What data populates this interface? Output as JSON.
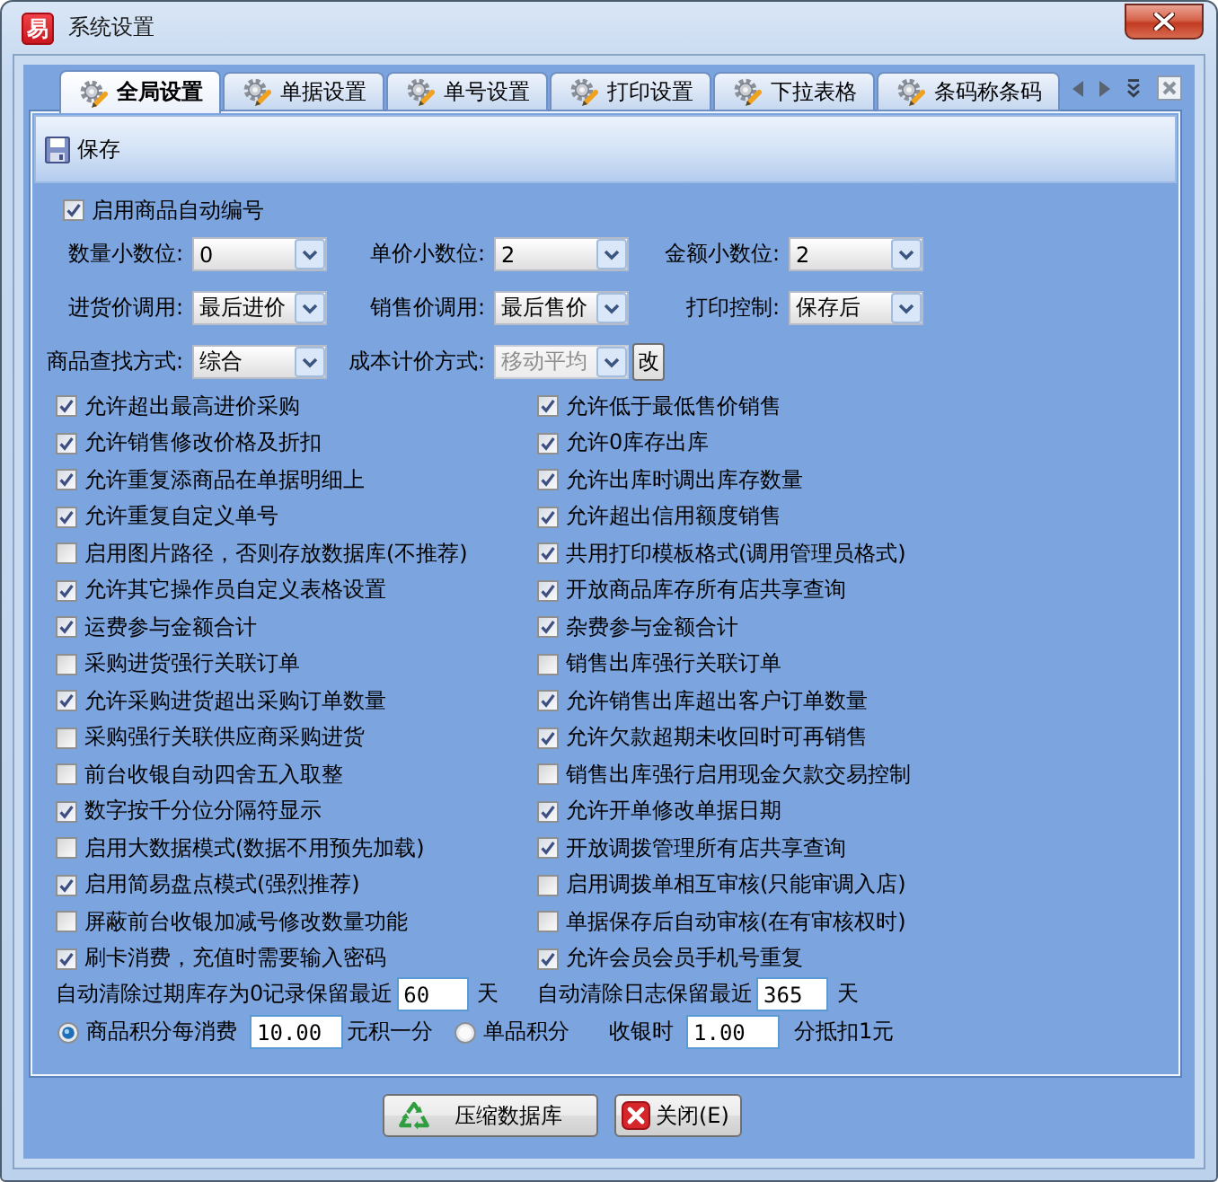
{
  "window": {
    "logo": "易",
    "title": "系统设置"
  },
  "tabs": [
    {
      "label": "全局设置",
      "selected": true
    },
    {
      "label": "单据设置",
      "selected": false
    },
    {
      "label": "单号设置",
      "selected": false
    },
    {
      "label": "打印设置",
      "selected": false
    },
    {
      "label": "下拉表格",
      "selected": false
    },
    {
      "label": "条码称条码",
      "selected": false
    }
  ],
  "toolbar": {
    "save": "保存"
  },
  "auto_numbering": {
    "label": "启用商品自动编号",
    "checked": true
  },
  "selects": [
    [
      {
        "label": "数量小数位:",
        "value": "0",
        "disabled": false
      },
      {
        "label": "单价小数位:",
        "value": "2",
        "disabled": false
      },
      {
        "label": "金额小数位:",
        "value": "2",
        "disabled": false
      }
    ],
    [
      {
        "label": "进货价调用:",
        "value": "最后进价",
        "disabled": false
      },
      {
        "label": "销售价调用:",
        "value": "最后售价",
        "disabled": false
      },
      {
        "label": "打印控制:",
        "value": "保存后",
        "disabled": false
      }
    ],
    [
      {
        "label": "商品查找方式:",
        "value": "综合",
        "disabled": false
      },
      {
        "label": "成本计价方式:",
        "value": "移动平均",
        "disabled": true
      }
    ]
  ],
  "change_button": "改",
  "options_left": [
    {
      "label": "允许超出最高进价采购",
      "checked": true
    },
    {
      "label": "允许销售修改价格及折扣",
      "checked": true
    },
    {
      "label": "允许重复添商品在单据明细上",
      "checked": true
    },
    {
      "label": "允许重复自定义单号",
      "checked": true
    },
    {
      "label": "启用图片路径，否则存放数据库(不推荐)",
      "checked": false
    },
    {
      "label": "允许其它操作员自定义表格设置",
      "checked": true
    },
    {
      "label": "运费参与金额合计",
      "checked": true
    },
    {
      "label": "采购进货强行关联订单",
      "checked": false
    },
    {
      "label": "允许采购进货超出采购订单数量",
      "checked": true
    },
    {
      "label": "采购强行关联供应商采购进货",
      "checked": false
    },
    {
      "label": "前台收银自动四舍五入取整",
      "checked": false
    },
    {
      "label": "数字按千分位分隔符显示",
      "checked": true
    },
    {
      "label": "启用大数据模式(数据不用预先加载)",
      "checked": false
    },
    {
      "label": "启用简易盘点模式(强烈推荐)",
      "checked": true
    },
    {
      "label": "屏蔽前台收银加减号修改数量功能",
      "checked": false
    },
    {
      "label": "刷卡消费，充值时需要输入密码",
      "checked": true
    }
  ],
  "options_right": [
    {
      "label": "允许低于最低售价销售",
      "checked": true
    },
    {
      "label": "允许0库存出库",
      "checked": true
    },
    {
      "label": "允许出库时调出库存数量",
      "checked": true
    },
    {
      "label": "允许超出信用额度销售",
      "checked": true
    },
    {
      "label": "共用打印模板格式(调用管理员格式)",
      "checked": true
    },
    {
      "label": "开放商品库存所有店共享查询",
      "checked": true
    },
    {
      "label": "杂费参与金额合计",
      "checked": true
    },
    {
      "label": "销售出库强行关联订单",
      "checked": false
    },
    {
      "label": "允许销售出库超出客户订单数量",
      "checked": true
    },
    {
      "label": "允许欠款超期未收回时可再销售",
      "checked": true
    },
    {
      "label": "销售出库强行启用现金欠款交易控制",
      "checked": false
    },
    {
      "label": "允许开单修改单据日期",
      "checked": true
    },
    {
      "label": "开放调拨管理所有店共享查询",
      "checked": true
    },
    {
      "label": "启用调拨单相互审核(只能审调入店)",
      "checked": false
    },
    {
      "label": "单据保存后自动审核(在有审核权时)",
      "checked": false
    },
    {
      "label": "允许会员会员手机号重复",
      "checked": true
    }
  ],
  "retention": [
    {
      "label": "自动清除过期库存为0记录保留最近",
      "value": "60",
      "unit": "天"
    },
    {
      "label": "自动清除日志保留最近",
      "value": "365",
      "unit": "天"
    }
  ],
  "points": {
    "options": [
      {
        "label": "商品积分每消费",
        "selected": true,
        "value": "10.00",
        "unit": "元积一分"
      },
      {
        "label": "单品积分",
        "selected": false
      }
    ],
    "redeem": {
      "label": "收银时",
      "value": "1.00",
      "unit": "分抵扣1元"
    }
  },
  "buttons": [
    {
      "kind": "compress",
      "label": "压缩数据库"
    },
    {
      "kind": "close",
      "label": "关闭(E)"
    }
  ]
}
